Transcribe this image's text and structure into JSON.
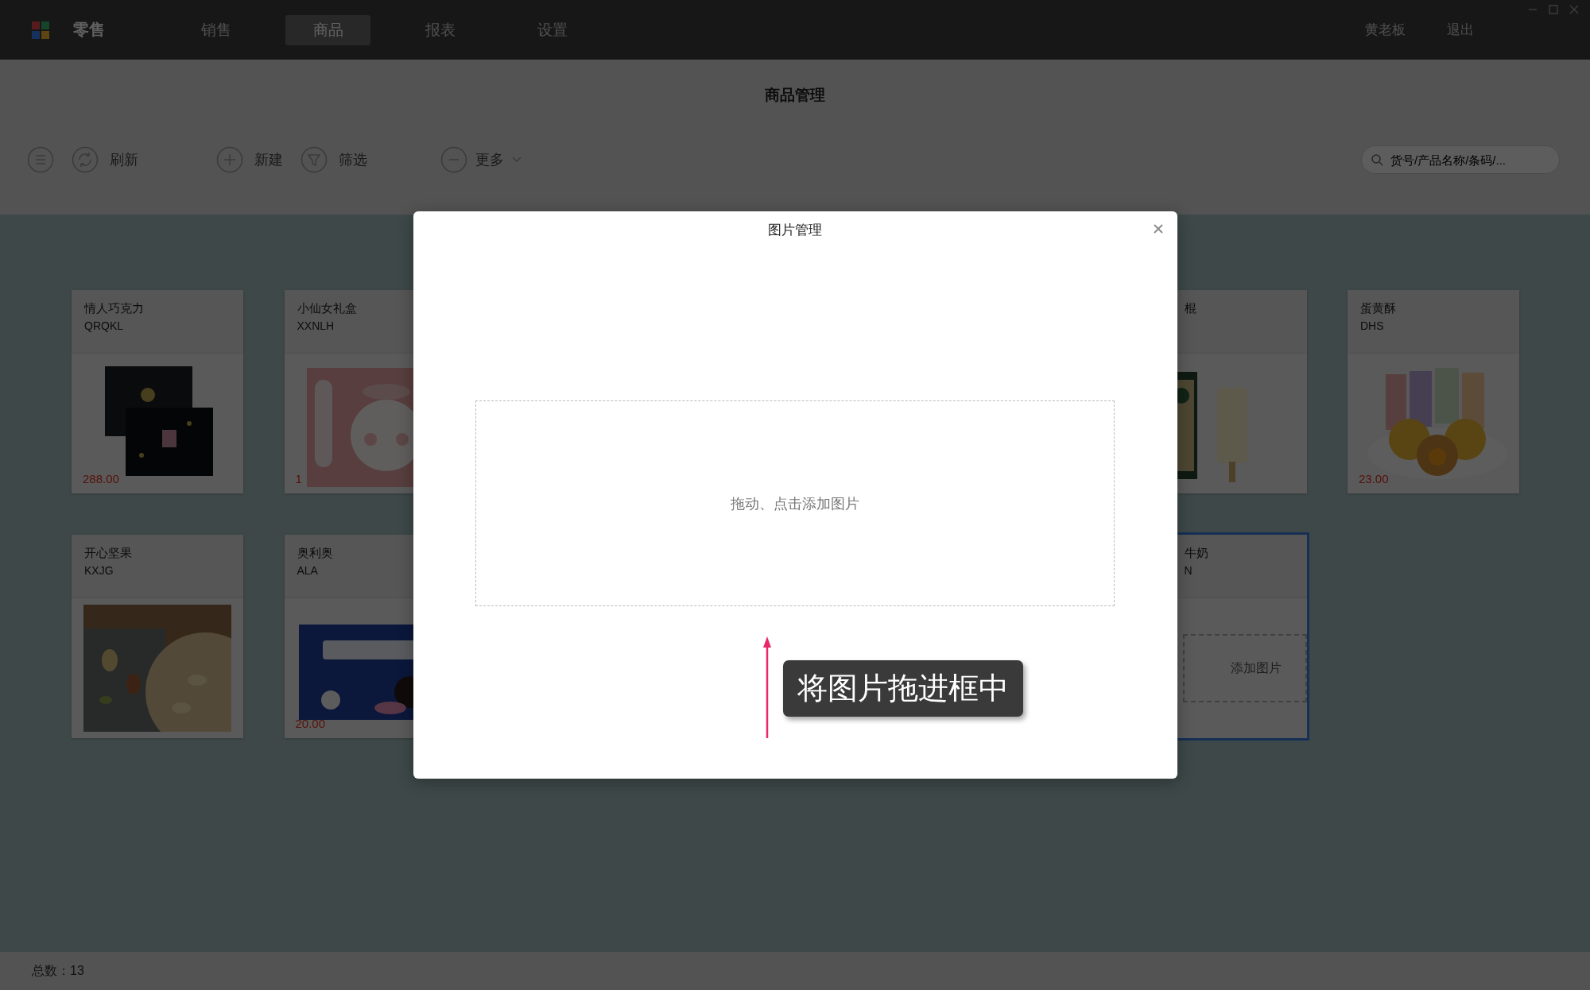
{
  "top_nav": {
    "brand": "零售",
    "tabs": [
      {
        "label": "销售",
        "selected": false
      },
      {
        "label": "商品",
        "selected": true
      },
      {
        "label": "报表",
        "selected": false
      },
      {
        "label": "设置",
        "selected": false
      }
    ],
    "user": "黄老板",
    "logout": "退出"
  },
  "page_title": "商品管理",
  "toolbar": {
    "buttons": [
      {
        "kind": "list"
      },
      {
        "kind": "refresh",
        "label": "刷新"
      },
      {
        "kind": "add",
        "label": "新建"
      },
      {
        "kind": "filter",
        "label": "筛选"
      },
      {
        "kind": "more",
        "label": "更多"
      }
    ],
    "search": {
      "placeholder": "货号/产品名称/条码/..."
    }
  },
  "product_rows": [
    {
      "left": [
        {
          "name": "情人巧克力",
          "code": "QRQKL",
          "price": "288.00",
          "selected": false
        },
        {
          "name": "小仙女礼盒",
          "code": "XXNLH",
          "price": "1",
          "selected": false
        }
      ],
      "right": [
        {
          "name": "棍",
          "selected": false
        },
        {
          "name": "蛋黄酥",
          "code": "DHS",
          "price": "23.00",
          "selected": false
        }
      ]
    },
    {
      "left": [
        {
          "name": "开心坚果",
          "code": "KXJG",
          "selected": false
        },
        {
          "name": "奥利奥",
          "code": "ALA",
          "price": "20.00",
          "selected": false
        }
      ],
      "right": [
        {
          "name": "牛奶",
          "code": "N",
          "kind": "empty",
          "add_label": "添加图片",
          "selected": true
        }
      ]
    }
  ],
  "status_bar": {
    "total": "总数：13"
  },
  "dialog": {
    "title": "图片管理",
    "dropzone_hint": "拖动、点击添加图片",
    "callout": "将图片拖进框中"
  }
}
